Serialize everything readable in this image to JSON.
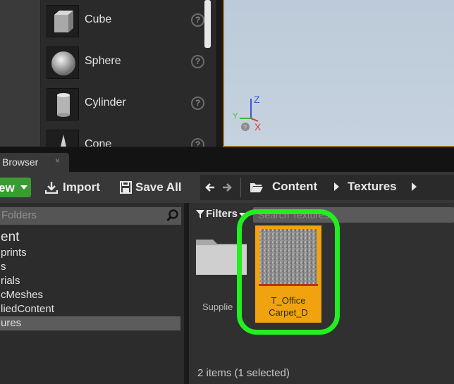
{
  "place_actors": {
    "items": [
      {
        "label": "Cube",
        "icon": "cube-icon"
      },
      {
        "label": "Sphere",
        "icon": "sphere-icon"
      },
      {
        "label": "Cylinder",
        "icon": "cylinder-icon"
      },
      {
        "label": "Cone",
        "icon": "cone-icon"
      }
    ],
    "help_glyph": "?"
  },
  "viewport": {
    "axis_x": "X",
    "axis_y": "Y",
    "axis_z": "Z"
  },
  "tab": {
    "label": "Browser",
    "close": "×"
  },
  "toolbar": {
    "new_label": "ew",
    "import_label": "Import",
    "save_all_label": "Save All",
    "breadcrumb": [
      "Content",
      "Textures"
    ]
  },
  "folders": {
    "search_placeholder": "Folders",
    "root": "ent",
    "items": [
      "prints",
      "s",
      "rials",
      "cMeshes",
      "liedContent",
      "ures"
    ],
    "selected_index": 5
  },
  "assets": {
    "filters_label": "Filters",
    "search_placeholder": "Search Textures",
    "folder_label": "Supplie",
    "texture_name_line1": "T_Office",
    "texture_name_line2": "Carpet_D",
    "status": "2 items (1 selected)"
  },
  "colors": {
    "accent_green": "#3b9b33",
    "selection_orange": "#f0a30f",
    "highlight_ring": "#22ee22"
  }
}
